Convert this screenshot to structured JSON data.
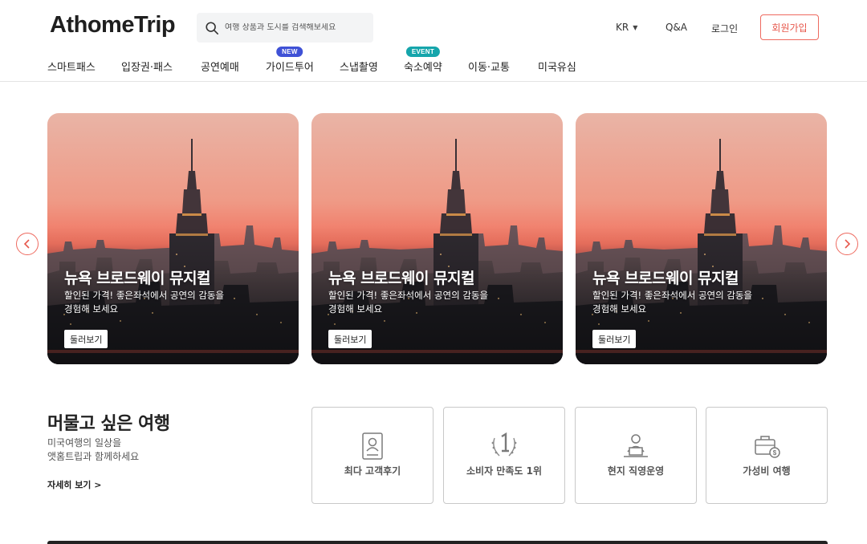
{
  "header": {
    "logo": "AthomeTrip",
    "search_placeholder": "여행 상품과 도시를 검색해보세요",
    "lang": "KR",
    "qa": "Q&A",
    "login": "로그인",
    "signup": "회원가입"
  },
  "nav": [
    {
      "label": "스마트패스"
    },
    {
      "label": "입장권·패스"
    },
    {
      "label": "공연예매"
    },
    {
      "label": "가이드투어",
      "badge": "NEW"
    },
    {
      "label": "스냅촬영"
    },
    {
      "label": "숙소예약",
      "badge": "EVENT"
    },
    {
      "label": "이동·교통"
    },
    {
      "label": "미국유심"
    }
  ],
  "slides": [
    {
      "title": "뉴욕 브로드웨이 뮤지컬",
      "desc1": "할인된 가격! 좋은좌석에서 공연의 감동을",
      "desc2": "경험해 보세요",
      "button": "둘러보기"
    },
    {
      "title": "뉴욕 브로드웨이 뮤지컬",
      "desc1": "할인된 가격! 좋은좌석에서 공연의 감동을",
      "desc2": "경험해 보세요",
      "button": "둘러보기"
    },
    {
      "title": "뉴욕 브로드웨이 뮤지컬",
      "desc1": "할인된 가격! 좋은좌석에서 공연의 감동을",
      "desc2": "경험해 보세요",
      "button": "둘러보기"
    }
  ],
  "section": {
    "title": "머물고 싶은 여행",
    "desc1": "미국여행의 일상을",
    "desc2": "앳홈트립과 함께하세요",
    "more": "자세히 보기 >"
  },
  "features": [
    {
      "label": "최다 고객후기",
      "icon": "review-card-icon"
    },
    {
      "label": "소비자 만족도 1위",
      "icon": "laurel-number-one-icon"
    },
    {
      "label": "현지 직영운영",
      "icon": "person-laptop-icon"
    },
    {
      "label": "가성비 여행",
      "icon": "suitcase-dollar-icon"
    }
  ],
  "colors": {
    "accent": "#ee6a5f",
    "badge_new": "#3f51d6",
    "badge_event": "#15a5ab"
  }
}
